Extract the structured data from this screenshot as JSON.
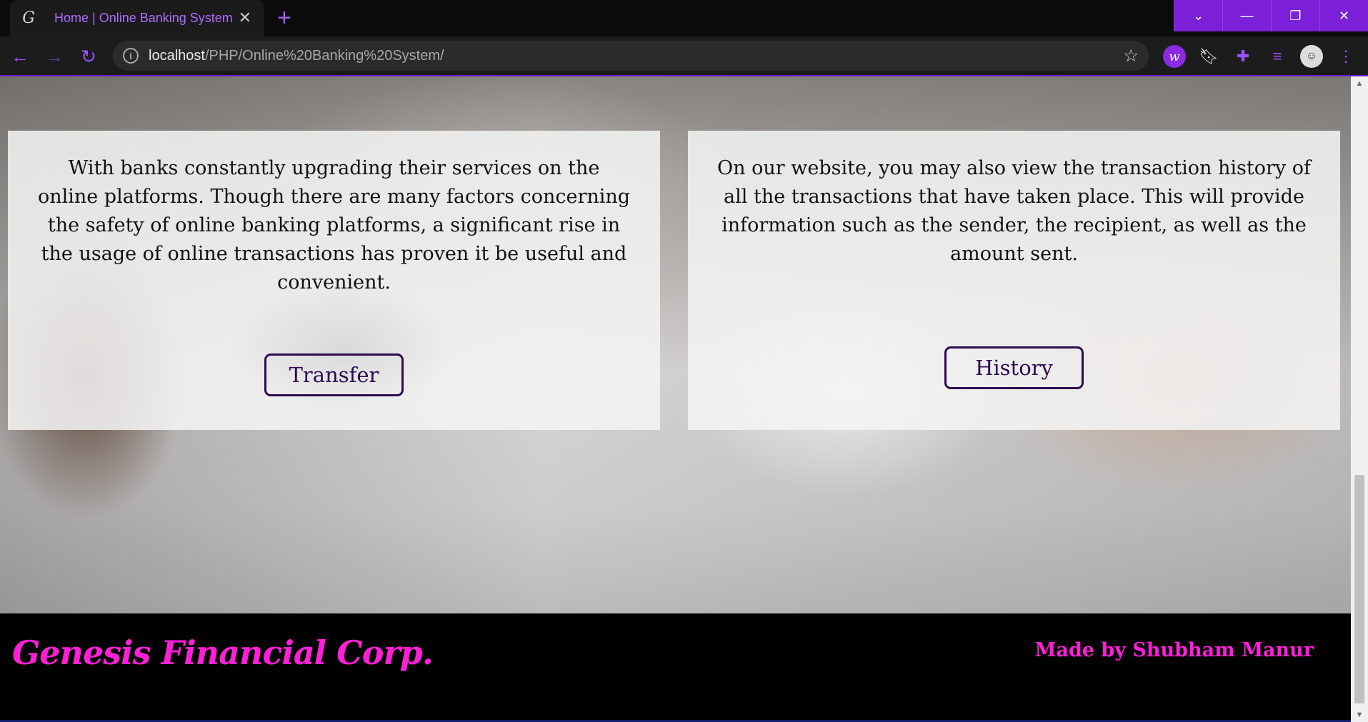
{
  "browser": {
    "tab": {
      "favicon": "G",
      "title": "Home | Online Banking System",
      "close_icon": "close-icon"
    },
    "new_tab_icon": "plus-icon",
    "window_controls": [
      "tab-search-icon",
      "minimize-icon",
      "restore-icon",
      "close-icon"
    ],
    "url": {
      "host": "localhost",
      "path": "/PHP/Online%20Banking%20System/"
    },
    "toolbar_icons": [
      "back-arrow-icon",
      "forward-arrow-icon",
      "reload-icon",
      "info-icon",
      "star-icon",
      "extension-w-icon",
      "bookmark-icon",
      "puzzle-icon",
      "playlist-icon",
      "profile-avatar",
      "menu-icon"
    ]
  },
  "page": {
    "cards": [
      {
        "text": "With banks constantly upgrading their services on the online platforms. Though there are many factors concerning the safety of online banking platforms, a significant rise in the usage of online transactions has proven it be useful and convenient.",
        "button": "Transfer"
      },
      {
        "text": "On our website, you may also view the transaction history of all the transactions that have taken place. This will provide information such as the sender, the recipient, as well as the amount sent.",
        "button": "History"
      }
    ],
    "footer": {
      "brand": "Genesis Financial Corp.",
      "credit": "Made by Shubham Manur"
    }
  },
  "colors": {
    "accent": "#7b1fd8",
    "brand": "#ff1fd7",
    "button_border": "#2e0a4f"
  },
  "scroll_position": 0.72
}
